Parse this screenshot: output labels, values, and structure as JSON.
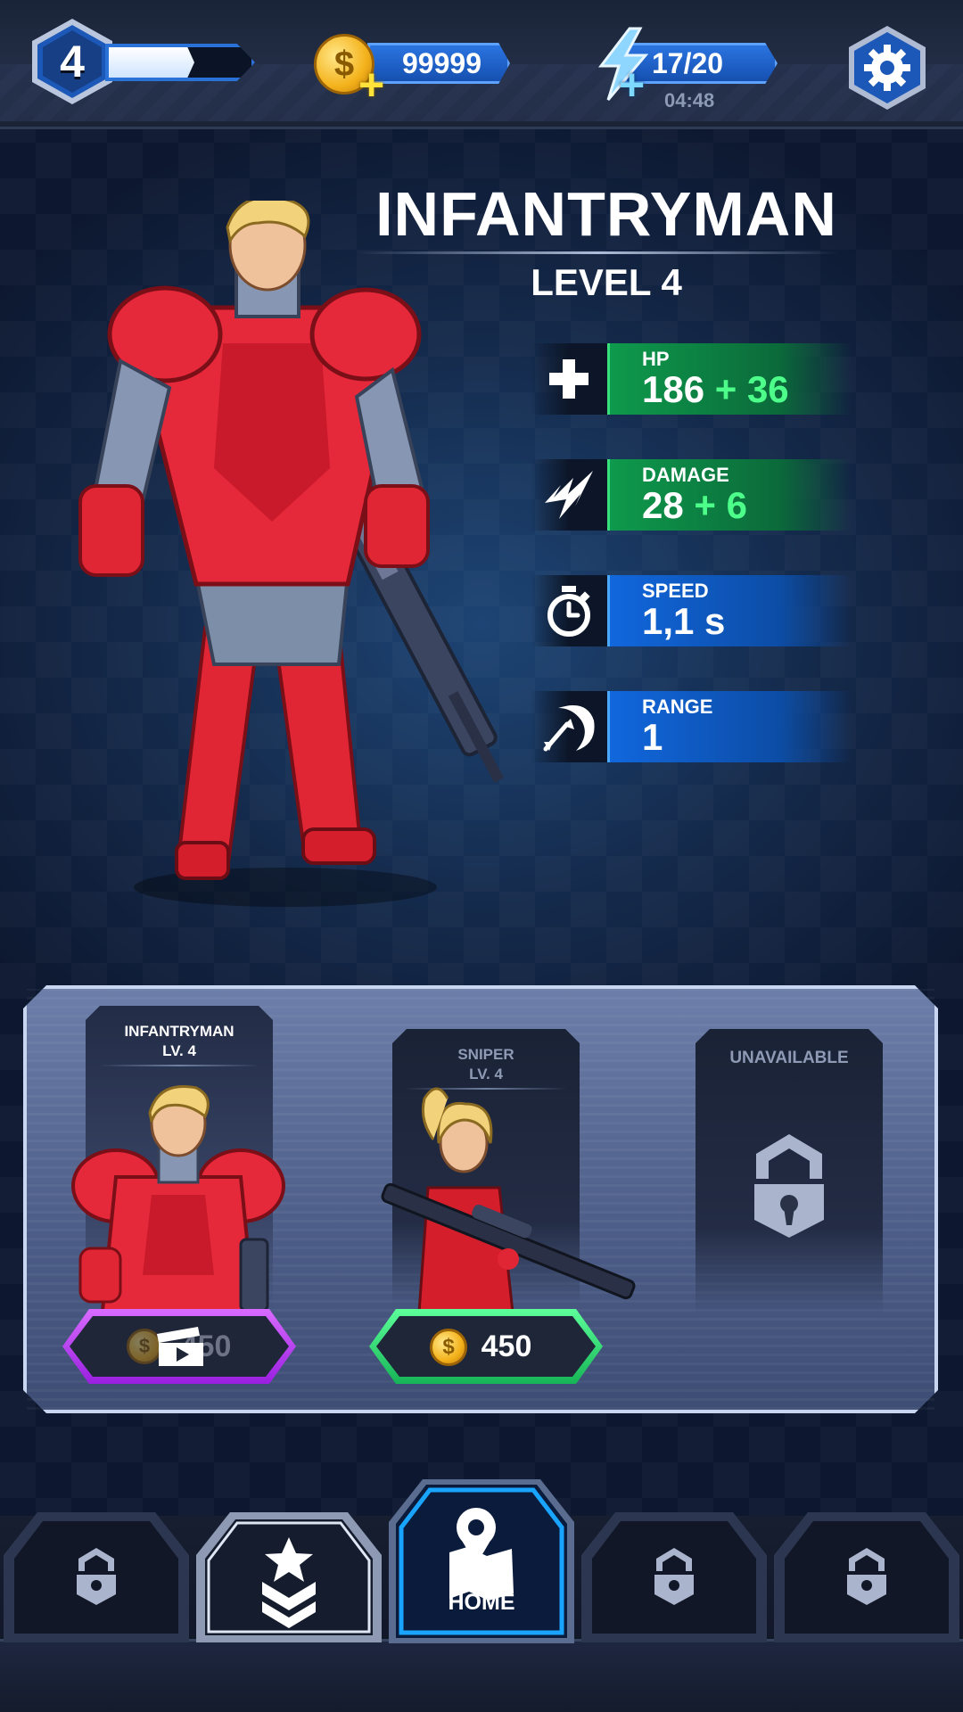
{
  "topbar": {
    "player_level": "4",
    "xp_progress": 0.6,
    "coins": "99999",
    "energy": "17/20",
    "energy_timer": "04:48"
  },
  "hero": {
    "name": "INFANTRYMAN",
    "level_text": "LEVEL 4",
    "stats": [
      {
        "icon": "plus-icon",
        "label": "HP",
        "value": "186",
        "bonus": "+ 36",
        "color": "green"
      },
      {
        "icon": "damage-icon",
        "label": "DAMAGE",
        "value": "28",
        "bonus": "+ 6",
        "color": "green"
      },
      {
        "icon": "stopwatch-icon",
        "label": "SPEED",
        "value": "1,1 s",
        "bonus": "",
        "color": "blue"
      },
      {
        "icon": "range-icon",
        "label": "RANGE",
        "value": "1",
        "bonus": "",
        "color": "blue"
      }
    ]
  },
  "roster": [
    {
      "name": "INFANTRYMAN",
      "level": "LV. 4",
      "price": "450",
      "button": "watch-ad",
      "selected": true
    },
    {
      "name": "SNIPER",
      "level": "LV. 4",
      "price": "450",
      "button": "coins",
      "selected": false
    },
    {
      "name": "UNAVAILABLE",
      "level": "",
      "price": "",
      "button": "",
      "selected": false
    }
  ],
  "nav": {
    "home_label": "HOME"
  },
  "colors": {
    "accent_blue": "#2a72d8",
    "stat_green": "#0e9a4c",
    "stat_blue": "#1167dd",
    "ad_purple": "#b133ff",
    "buy_green": "#22d36a",
    "coin_gold": "#f4b21c"
  }
}
